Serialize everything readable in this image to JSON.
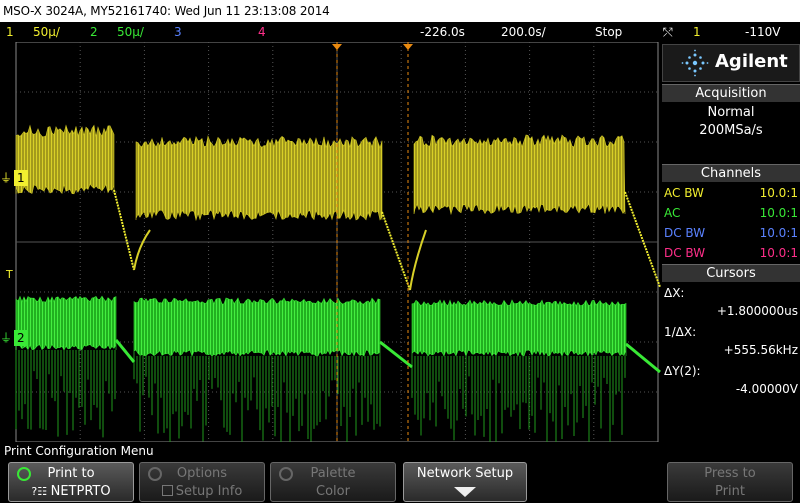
{
  "title_bar": {
    "text": "MSO-X 3024A, MY52161740: Wed Jun 11 23:13:08 2014"
  },
  "status_bar": {
    "ch1_num": "1",
    "ch1_scale": "50μ/",
    "ch2_num": "2",
    "ch2_scale": "50μ/",
    "ch3_num": "3",
    "ch4_num": "4",
    "delay": "-226.0s",
    "timebase": "200.0s/",
    "run_state": "Stop",
    "trig_source": "1",
    "trig_level": "-110V"
  },
  "channel_markers": {
    "ch1": "1",
    "ch2": "2",
    "trigger": "T"
  },
  "side_panel": {
    "brand": "Agilent",
    "acquisition_header": "Acquisition",
    "acq_mode": "Normal",
    "acq_rate": "200MSa/s",
    "channels_header": "Channels",
    "channels": [
      {
        "coupling": "AC BW",
        "probe": "10.0:1",
        "color": "#f2ef2f"
      },
      {
        "coupling": "AC",
        "probe": "10.0:1",
        "color": "#39e836"
      },
      {
        "coupling": "DC BW",
        "probe": "10.0:1",
        "color": "#5a82ff"
      },
      {
        "coupling": "DC BW",
        "probe": "10.0:1",
        "color": "#ff2f8a"
      }
    ],
    "cursors_header": "Cursors",
    "dx_label": "ΔX:",
    "dx_value": "+1.800000us",
    "inv_dx_label": "1/ΔX:",
    "inv_dx_value": "+555.56kHz",
    "dy_label": "ΔY(2):",
    "dy_value": "-4.00000V"
  },
  "menu_title": "Print Configuration Menu",
  "softkeys": [
    {
      "line1": "Print to",
      "line2": "NETPRTO"
    },
    {
      "line1": "Options",
      "line2": "Setup Info"
    },
    {
      "line1": "Palette",
      "line2": "Color"
    },
    {
      "line1": "Network Setup"
    },
    {
      "line1": "Press to",
      "line2": "Print"
    }
  ],
  "colors": {
    "ch1": "#f2ef2f",
    "ch2": "#39e836",
    "ch3": "#5a82ff",
    "ch4": "#ff2f8a"
  }
}
